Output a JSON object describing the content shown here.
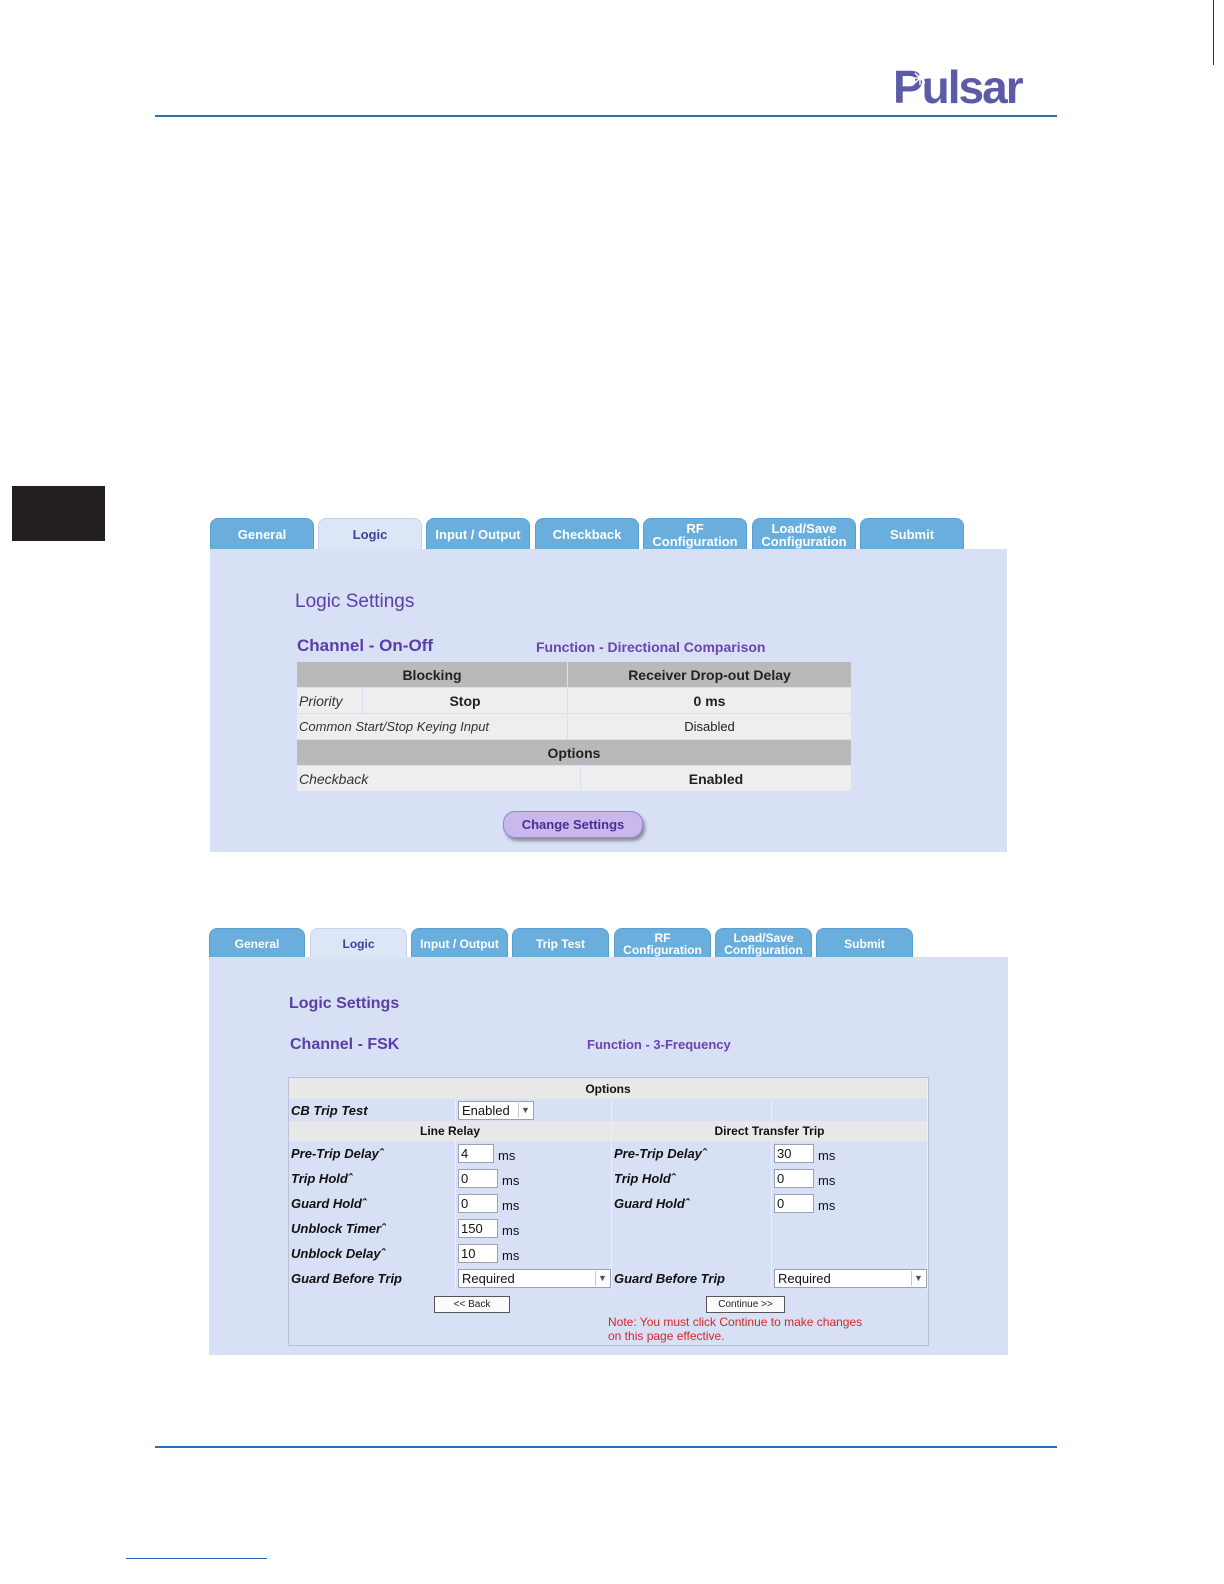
{
  "brand": {
    "logo_text": "Pulsar",
    "logo_color": "#5b5ba7"
  },
  "figure1": {
    "tabs": [
      "General",
      "Logic",
      "Input / Output",
      "Checkback",
      "RF Configuration",
      "Load/Save Configuration",
      "Submit"
    ],
    "tab_lines": {
      "rf": [
        "RF",
        "Configuration"
      ],
      "loadsave": [
        "Load/Save",
        "Configuration"
      ]
    },
    "active_tab": "Logic",
    "title": "Logic Settings",
    "channel": "Channel - On-Off",
    "function": "Function - Directional Comparison",
    "table": {
      "header_left": "Blocking",
      "header_right": "Receiver Drop-out Delay",
      "priority_label": "Priority",
      "priority_value": "Stop",
      "dropout_value": "0 ms",
      "keying_label": "Common Start/Stop Keying Input",
      "keying_value": "Disabled",
      "options_header": "Options",
      "checkback_label": "Checkback",
      "checkback_value": "Enabled"
    },
    "button": "Change Settings"
  },
  "figure2": {
    "tabs": [
      "General",
      "Logic",
      "Input / Output",
      "Trip Test",
      "RF Configuration",
      "Load/Save Configuration",
      "Submit"
    ],
    "tab_lines": {
      "rf": [
        "RF",
        "Configuration"
      ],
      "loadsave": [
        "Load/Save",
        "Configuration"
      ]
    },
    "active_tab": "Logic",
    "title": "Logic Settings",
    "channel": "Channel - FSK",
    "function": "Function - 3-Frequency",
    "options_header": "Options",
    "cb_trip_test_label": "CB Trip Test",
    "cb_trip_test_value": "Enabled",
    "line_relay_header": "Line Relay",
    "dtt_header": "Direct Transfer Trip",
    "line_relay": {
      "pre_trip_delay_label": "Pre-Trip Delayˆ",
      "pre_trip_delay_value": "4",
      "trip_hold_label": "Trip Holdˆ",
      "trip_hold_value": "0",
      "guard_hold_label": "Guard Holdˆ",
      "guard_hold_value": "0",
      "unblock_timer_label": "Unblock Timerˆ",
      "unblock_timer_value": "150",
      "unblock_delay_label": "Unblock Delayˆ",
      "unblock_delay_value": "10",
      "guard_before_trip_label": "Guard Before Trip",
      "guard_before_trip_value": "Required"
    },
    "dtt": {
      "pre_trip_delay_label": "Pre-Trip Delayˆ",
      "pre_trip_delay_value": "30",
      "trip_hold_label": "Trip Holdˆ",
      "trip_hold_value": "0",
      "guard_hold_label": "Guard Holdˆ",
      "guard_hold_value": "0",
      "guard_before_trip_label": "Guard Before Trip",
      "guard_before_trip_value": "Required"
    },
    "unit": "ms",
    "back_button": "<< Back",
    "continue_button": "Continue >>",
    "note_line1": "Note: You must click Continue to make changes",
    "note_line2": "on this page effective."
  }
}
